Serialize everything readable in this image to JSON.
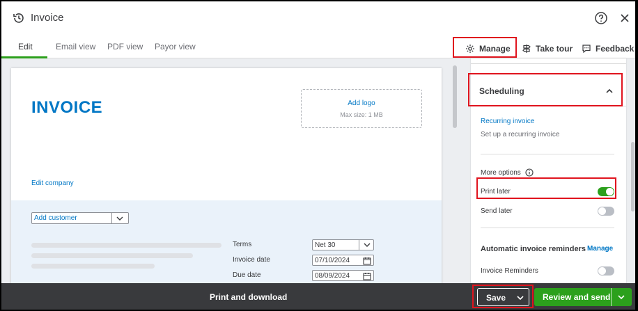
{
  "header": {
    "title": "Invoice",
    "icons": [
      "history-icon",
      "help-icon",
      "close-icon"
    ]
  },
  "tabs": [
    {
      "label": "Edit",
      "active": true
    },
    {
      "label": "Email view",
      "active": false
    },
    {
      "label": "PDF view",
      "active": false
    },
    {
      "label": "Payor view",
      "active": false
    }
  ],
  "toolbar": {
    "manage": "Manage",
    "take_tour": "Take tour",
    "feedback": "Feedback"
  },
  "invoice": {
    "heading": "INVOICE",
    "add_logo": "Add logo",
    "max_size": "Max size: 1 MB",
    "edit_company": "Edit company",
    "customer_placeholder": "Add customer",
    "fields": {
      "terms_label": "Terms",
      "terms_value": "Net 30",
      "invoice_date_label": "Invoice date",
      "invoice_date_value": "07/10/2024",
      "due_date_label": "Due date",
      "due_date_value": "08/09/2024"
    }
  },
  "panel": {
    "section_title": "Scheduling",
    "recurring_link": "Recurring invoice",
    "recurring_desc": "Set up a recurring invoice",
    "more_options": "More options",
    "print_later": "Print later",
    "print_later_on": true,
    "send_later": "Send later",
    "send_later_on": false,
    "reminders_title": "Automatic invoice reminders",
    "reminders_manage": "Manage",
    "invoice_reminders": "Invoice Reminders",
    "invoice_reminders_on": false
  },
  "footer": {
    "print_download": "Print and download",
    "save": "Save",
    "review_send": "Review and send"
  },
  "colors": {
    "accent_green": "#2ca01c",
    "link_blue": "#0077c5",
    "highlight_red": "#e0141e",
    "footer_bg": "#393a3d"
  }
}
